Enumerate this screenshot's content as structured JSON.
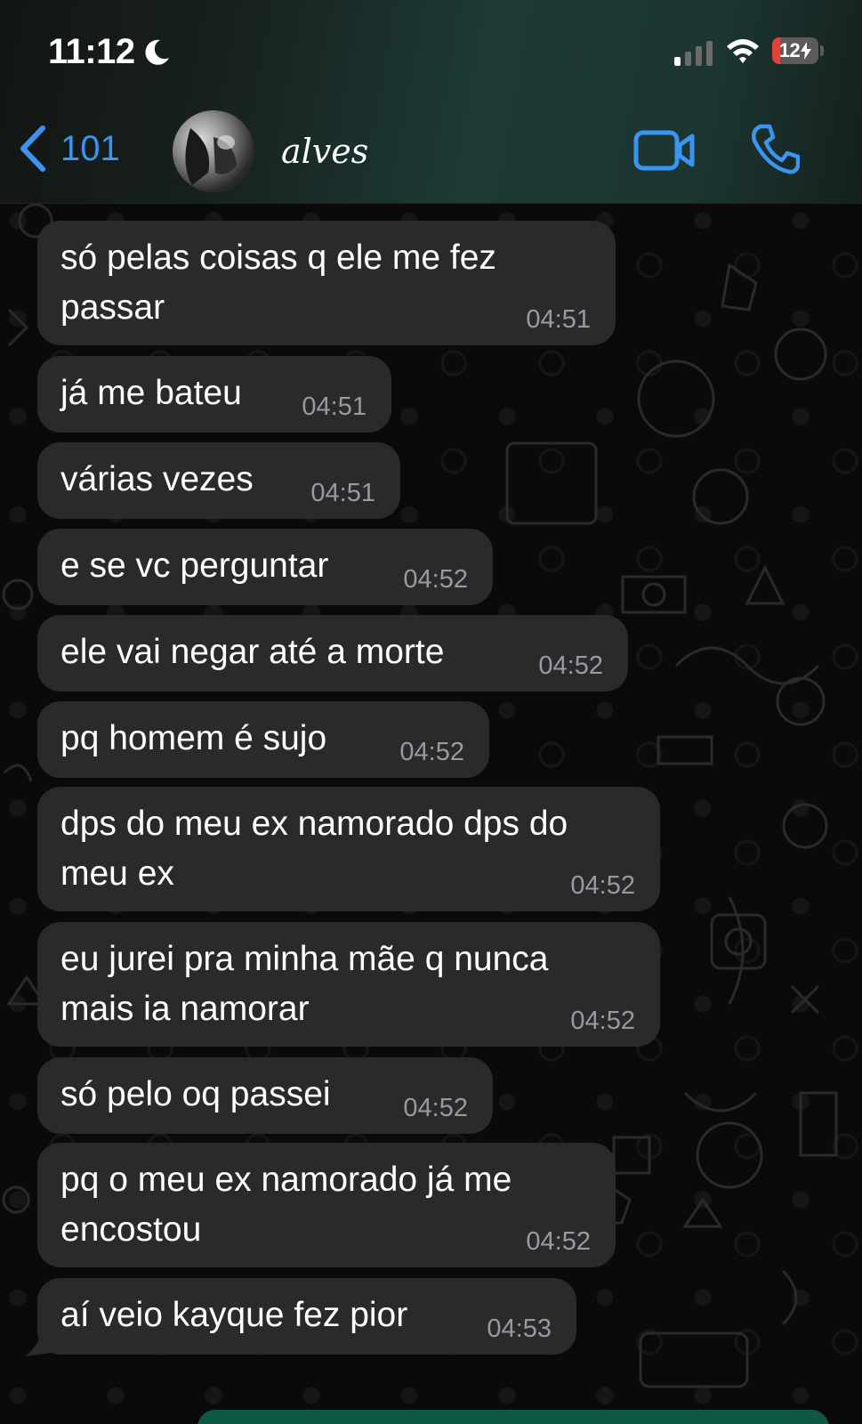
{
  "status_bar": {
    "time": "11:12",
    "battery": "12"
  },
  "header": {
    "back_count": "101",
    "contact_name": "alves"
  },
  "messages": [
    {
      "text": "só pelas coisas q ele me fez\npassar",
      "time": "04:51"
    },
    {
      "text": "já me bateu",
      "time": "04:51"
    },
    {
      "text": "várias vezes",
      "time": "04:51"
    },
    {
      "text": "e se vc perguntar",
      "time": "04:52"
    },
    {
      "text": "ele vai negar até a morte",
      "time": "04:52"
    },
    {
      "text": "pq homem é sujo",
      "time": "04:52"
    },
    {
      "text": "dps do meu ex namorado dps do\nmeu ex",
      "time": "04:52"
    },
    {
      "text": "eu jurei pra minha mãe q nunca\nmais ia namorar",
      "time": "04:52"
    },
    {
      "text": "só pelo oq passei",
      "time": "04:52"
    },
    {
      "text": "pq o meu ex namorado já me\nencostou",
      "time": "04:52"
    },
    {
      "text": "aí veio kayque fez pior",
      "time": "04:53"
    }
  ],
  "colors": {
    "accent": "#3a94f0",
    "bubble": "#2a2a2c",
    "timestamp": "#9a9a9e",
    "battery_low": "#e0413b"
  },
  "icons": [
    "moon-icon",
    "cellular-signal-icon",
    "wifi-icon",
    "battery-icon",
    "back-chevron-icon",
    "video-call-icon",
    "phone-call-icon"
  ]
}
